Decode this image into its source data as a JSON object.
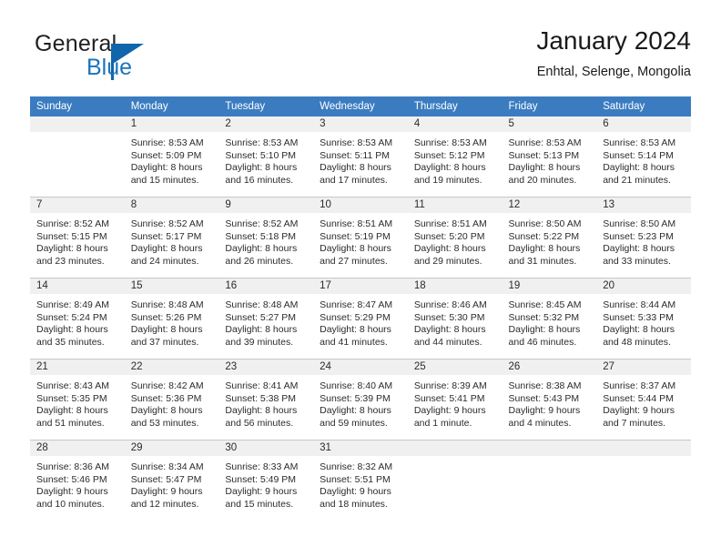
{
  "brand": {
    "name_top": "General",
    "name_bottom": "Blue",
    "accent_color": "#1065ab"
  },
  "header": {
    "title": "January 2024",
    "subtitle": "Enhtal, Selenge, Mongolia"
  },
  "theme": {
    "header_row_bg": "#3b7cc0",
    "daynum_band_bg": "#f0f0f0",
    "grid_line": "#c8c8c8"
  },
  "weekday_headers": [
    "Sunday",
    "Monday",
    "Tuesday",
    "Wednesday",
    "Thursday",
    "Friday",
    "Saturday"
  ],
  "weeks": [
    [
      {
        "day": "",
        "lines": []
      },
      {
        "day": "1",
        "lines": [
          "Sunrise: 8:53 AM",
          "Sunset: 5:09 PM",
          "Daylight: 8 hours",
          "and 15 minutes."
        ]
      },
      {
        "day": "2",
        "lines": [
          "Sunrise: 8:53 AM",
          "Sunset: 5:10 PM",
          "Daylight: 8 hours",
          "and 16 minutes."
        ]
      },
      {
        "day": "3",
        "lines": [
          "Sunrise: 8:53 AM",
          "Sunset: 5:11 PM",
          "Daylight: 8 hours",
          "and 17 minutes."
        ]
      },
      {
        "day": "4",
        "lines": [
          "Sunrise: 8:53 AM",
          "Sunset: 5:12 PM",
          "Daylight: 8 hours",
          "and 19 minutes."
        ]
      },
      {
        "day": "5",
        "lines": [
          "Sunrise: 8:53 AM",
          "Sunset: 5:13 PM",
          "Daylight: 8 hours",
          "and 20 minutes."
        ]
      },
      {
        "day": "6",
        "lines": [
          "Sunrise: 8:53 AM",
          "Sunset: 5:14 PM",
          "Daylight: 8 hours",
          "and 21 minutes."
        ]
      }
    ],
    [
      {
        "day": "7",
        "lines": [
          "Sunrise: 8:52 AM",
          "Sunset: 5:15 PM",
          "Daylight: 8 hours",
          "and 23 minutes."
        ]
      },
      {
        "day": "8",
        "lines": [
          "Sunrise: 8:52 AM",
          "Sunset: 5:17 PM",
          "Daylight: 8 hours",
          "and 24 minutes."
        ]
      },
      {
        "day": "9",
        "lines": [
          "Sunrise: 8:52 AM",
          "Sunset: 5:18 PM",
          "Daylight: 8 hours",
          "and 26 minutes."
        ]
      },
      {
        "day": "10",
        "lines": [
          "Sunrise: 8:51 AM",
          "Sunset: 5:19 PM",
          "Daylight: 8 hours",
          "and 27 minutes."
        ]
      },
      {
        "day": "11",
        "lines": [
          "Sunrise: 8:51 AM",
          "Sunset: 5:20 PM",
          "Daylight: 8 hours",
          "and 29 minutes."
        ]
      },
      {
        "day": "12",
        "lines": [
          "Sunrise: 8:50 AM",
          "Sunset: 5:22 PM",
          "Daylight: 8 hours",
          "and 31 minutes."
        ]
      },
      {
        "day": "13",
        "lines": [
          "Sunrise: 8:50 AM",
          "Sunset: 5:23 PM",
          "Daylight: 8 hours",
          "and 33 minutes."
        ]
      }
    ],
    [
      {
        "day": "14",
        "lines": [
          "Sunrise: 8:49 AM",
          "Sunset: 5:24 PM",
          "Daylight: 8 hours",
          "and 35 minutes."
        ]
      },
      {
        "day": "15",
        "lines": [
          "Sunrise: 8:48 AM",
          "Sunset: 5:26 PM",
          "Daylight: 8 hours",
          "and 37 minutes."
        ]
      },
      {
        "day": "16",
        "lines": [
          "Sunrise: 8:48 AM",
          "Sunset: 5:27 PM",
          "Daylight: 8 hours",
          "and 39 minutes."
        ]
      },
      {
        "day": "17",
        "lines": [
          "Sunrise: 8:47 AM",
          "Sunset: 5:29 PM",
          "Daylight: 8 hours",
          "and 41 minutes."
        ]
      },
      {
        "day": "18",
        "lines": [
          "Sunrise: 8:46 AM",
          "Sunset: 5:30 PM",
          "Daylight: 8 hours",
          "and 44 minutes."
        ]
      },
      {
        "day": "19",
        "lines": [
          "Sunrise: 8:45 AM",
          "Sunset: 5:32 PM",
          "Daylight: 8 hours",
          "and 46 minutes."
        ]
      },
      {
        "day": "20",
        "lines": [
          "Sunrise: 8:44 AM",
          "Sunset: 5:33 PM",
          "Daylight: 8 hours",
          "and 48 minutes."
        ]
      }
    ],
    [
      {
        "day": "21",
        "lines": [
          "Sunrise: 8:43 AM",
          "Sunset: 5:35 PM",
          "Daylight: 8 hours",
          "and 51 minutes."
        ]
      },
      {
        "day": "22",
        "lines": [
          "Sunrise: 8:42 AM",
          "Sunset: 5:36 PM",
          "Daylight: 8 hours",
          "and 53 minutes."
        ]
      },
      {
        "day": "23",
        "lines": [
          "Sunrise: 8:41 AM",
          "Sunset: 5:38 PM",
          "Daylight: 8 hours",
          "and 56 minutes."
        ]
      },
      {
        "day": "24",
        "lines": [
          "Sunrise: 8:40 AM",
          "Sunset: 5:39 PM",
          "Daylight: 8 hours",
          "and 59 minutes."
        ]
      },
      {
        "day": "25",
        "lines": [
          "Sunrise: 8:39 AM",
          "Sunset: 5:41 PM",
          "Daylight: 9 hours",
          "and 1 minute."
        ]
      },
      {
        "day": "26",
        "lines": [
          "Sunrise: 8:38 AM",
          "Sunset: 5:43 PM",
          "Daylight: 9 hours",
          "and 4 minutes."
        ]
      },
      {
        "day": "27",
        "lines": [
          "Sunrise: 8:37 AM",
          "Sunset: 5:44 PM",
          "Daylight: 9 hours",
          "and 7 minutes."
        ]
      }
    ],
    [
      {
        "day": "28",
        "lines": [
          "Sunrise: 8:36 AM",
          "Sunset: 5:46 PM",
          "Daylight: 9 hours",
          "and 10 minutes."
        ]
      },
      {
        "day": "29",
        "lines": [
          "Sunrise: 8:34 AM",
          "Sunset: 5:47 PM",
          "Daylight: 9 hours",
          "and 12 minutes."
        ]
      },
      {
        "day": "30",
        "lines": [
          "Sunrise: 8:33 AM",
          "Sunset: 5:49 PM",
          "Daylight: 9 hours",
          "and 15 minutes."
        ]
      },
      {
        "day": "31",
        "lines": [
          "Sunrise: 8:32 AM",
          "Sunset: 5:51 PM",
          "Daylight: 9 hours",
          "and 18 minutes."
        ]
      },
      {
        "day": "",
        "lines": []
      },
      {
        "day": "",
        "lines": []
      },
      {
        "day": "",
        "lines": []
      }
    ]
  ]
}
